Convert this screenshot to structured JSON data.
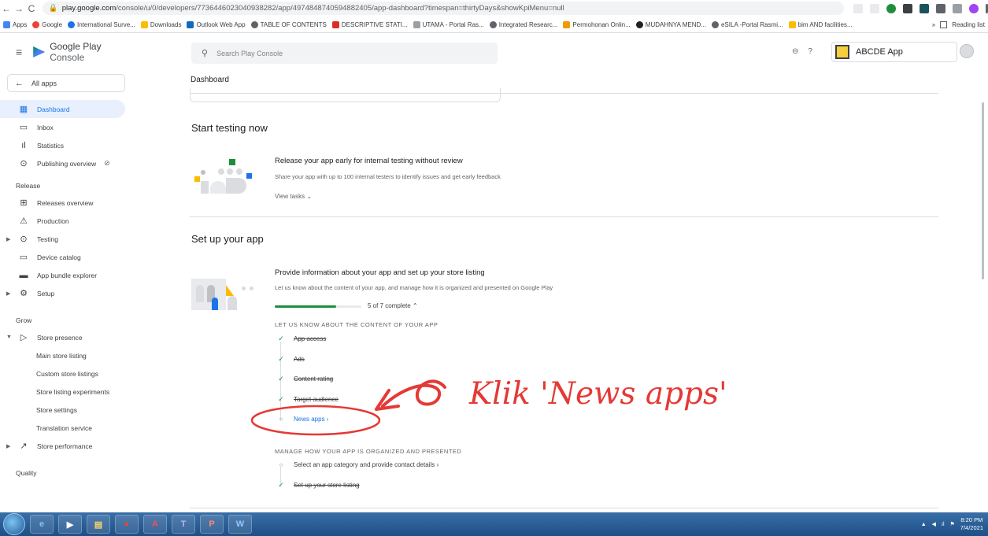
{
  "browser": {
    "url_host": "play.google.com",
    "url_path": "/console/u/0/developers/7736446023040938282/app/4974848740594882405/app-dashboard?timespan=thirtyDays&showKpiMenu=null",
    "bookmarks": [
      "Apps",
      "Google",
      "International Surve...",
      "Downloads",
      "Outlook Web App",
      "TABLE OF CONTENTS",
      "DESCRIPTIVE STATI...",
      "UTAMA - Portal Ras...",
      "Integrated Researc...",
      "Permohonan Onlin...",
      "MUDAHNYA MEND...",
      "eSILA -Portal Rasmi...",
      "bim AND facilities..."
    ],
    "reading_list": "Reading list"
  },
  "header": {
    "brand": "Google Play Console",
    "brand_main": "Google Play",
    "brand_suffix": "Console",
    "search_placeholder": "Search Play Console",
    "app_name": "ABCDE App",
    "page_title": "Dashboard"
  },
  "sidebar": {
    "all_apps": "All apps",
    "items": [
      {
        "label": "Dashboard",
        "icon": "dashboard-icon"
      },
      {
        "label": "Inbox",
        "icon": "inbox-icon"
      },
      {
        "label": "Statistics",
        "icon": "statistics-icon"
      },
      {
        "label": "Publishing overview",
        "icon": "publishing-icon"
      }
    ],
    "release_label": "Release",
    "release_items": [
      {
        "label": "Releases overview",
        "icon": "releases-icon"
      },
      {
        "label": "Production",
        "icon": "production-icon"
      },
      {
        "label": "Testing",
        "icon": "testing-icon"
      },
      {
        "label": "Device catalog",
        "icon": "device-icon"
      },
      {
        "label": "App bundle explorer",
        "icon": "bundle-icon"
      },
      {
        "label": "Setup",
        "icon": "setup-icon"
      }
    ],
    "grow_label": "Grow",
    "store_presence": "Store presence",
    "store_items": [
      "Main store listing",
      "Custom store listings",
      "Store listing experiments",
      "Store settings",
      "Translation service"
    ],
    "store_performance": "Store performance",
    "quality_label": "Quality"
  },
  "main": {
    "testing": {
      "section_title": "Start testing now",
      "task_title": "Release your app early for internal testing without review",
      "task_desc": "Share your app with up to 100 internal testers to identify issues and get early feedback",
      "view_tasks": "View tasks"
    },
    "setup": {
      "section_title": "Set up your app",
      "task_title": "Provide information about your app and set up your store listing",
      "task_desc": "Let us know about the content of your app, and manage how it is organized and presented on Google Play",
      "progress_text": "5 of 7 complete",
      "progress_fraction": 0.71,
      "group1_label": "LET US KNOW ABOUT THE CONTENT OF YOUR APP",
      "group1_steps": [
        {
          "label": "App access",
          "done": true
        },
        {
          "label": "Ads",
          "done": true
        },
        {
          "label": "Content rating",
          "done": true
        },
        {
          "label": "Target audience",
          "done": true
        },
        {
          "label": "News apps ›",
          "done": false
        }
      ],
      "group2_label": "MANAGE HOW YOUR APP IS ORGANIZED AND PRESENTED",
      "group2_steps": [
        {
          "label": "Select an app category and provide contact details ›",
          "done": false
        },
        {
          "label": "Set up your store listing",
          "done": true
        }
      ]
    }
  },
  "annotation": {
    "text": "Klik 'News apps'",
    "color": "#e53935"
  },
  "taskbar": {
    "time": "8:20 PM",
    "date": "7/4/2021"
  }
}
